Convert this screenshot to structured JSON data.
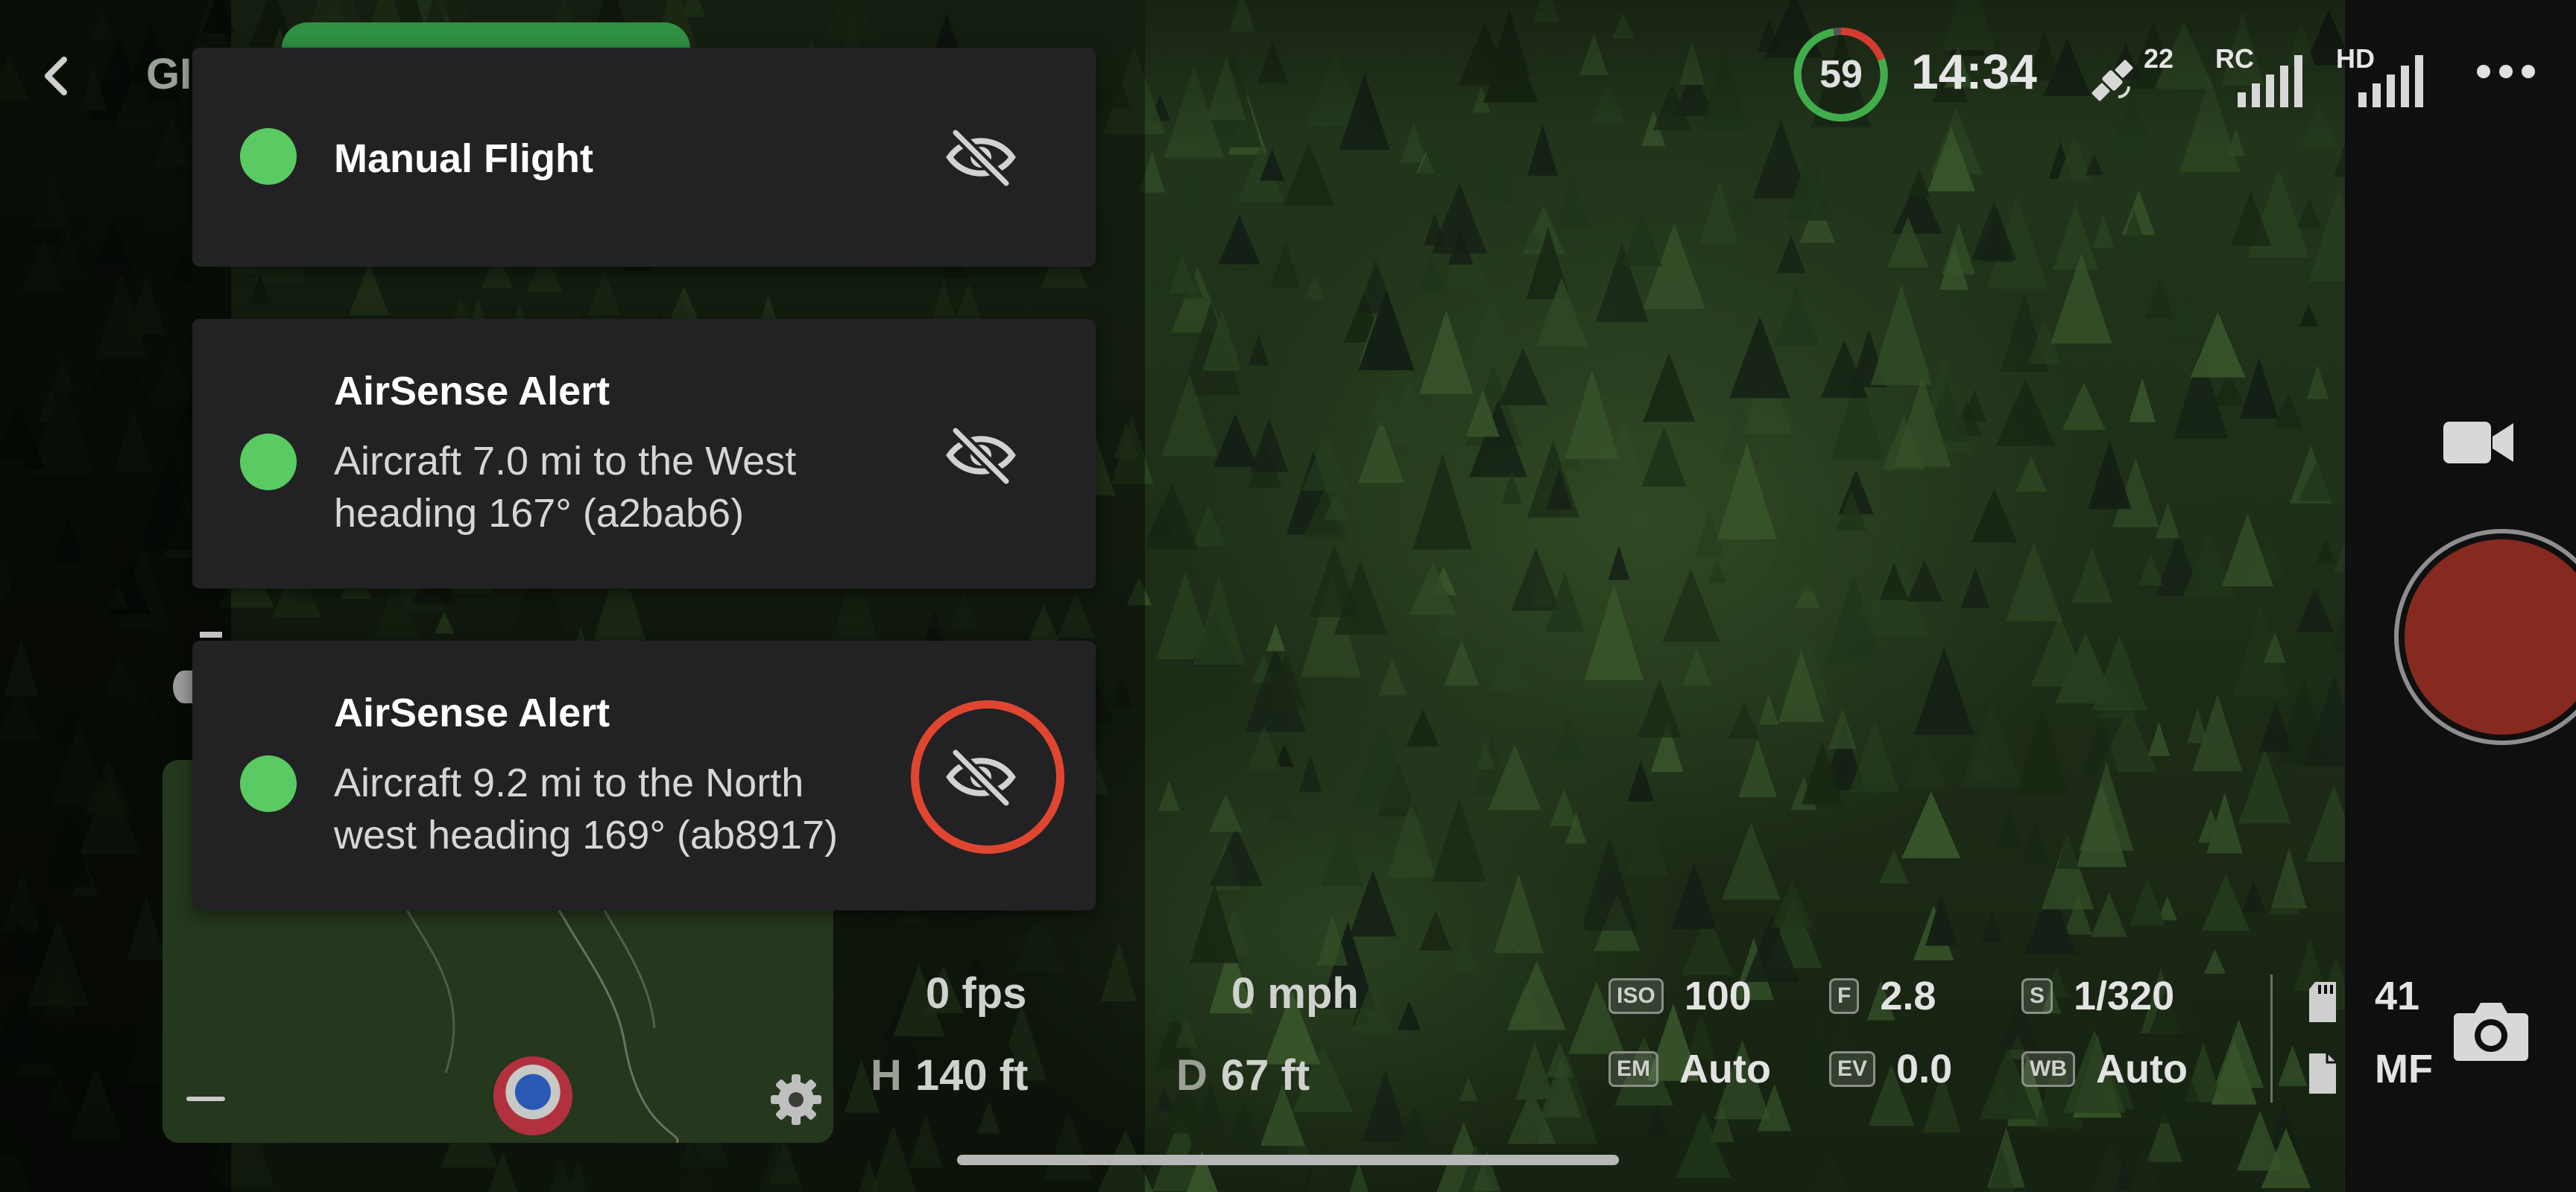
{
  "header": {
    "title_partial": "GI",
    "battery_percent": "59",
    "clock": "14:34",
    "satellite_count": "22",
    "rc_label": "RC",
    "hd_label": "HD"
  },
  "notifications": [
    {
      "title": "Manual Flight",
      "status_color": "#5acb63"
    },
    {
      "title": "AirSense Alert",
      "line1": "Aircraft 7.0 mi to the West",
      "line2": "heading 167° (a2bab6)",
      "status_color": "#5acb63"
    },
    {
      "title": "AirSense Alert",
      "line1": "Aircraft 9.2 mi to the North",
      "line2": "west heading 169° (ab8917)",
      "status_color": "#5acb63"
    }
  ],
  "telemetry": {
    "fps": "0 fps",
    "speed": "0 mph",
    "height_label": "H",
    "height": "140 ft",
    "distance_label": "D",
    "distance": "67 ft"
  },
  "camera": {
    "iso_tag": "ISO",
    "iso": "100",
    "f_tag": "F",
    "f": "2.8",
    "s_tag": "S",
    "shutter": "1/320",
    "em_tag": "EM",
    "exposure_mode": "Auto",
    "ev_tag": "EV",
    "ev": "0.0",
    "wb_tag": "WB",
    "wb": "Auto"
  },
  "storage": {
    "capacity_partial": "41",
    "format_partial": "MF"
  },
  "colors": {
    "accent_green": "#5acb63",
    "highlight_red": "#e0462f",
    "record_red": "#862a1f"
  },
  "icons": [
    "back-chevron-icon",
    "eye-off-icon",
    "gear-icon",
    "satellite-icon",
    "signal-bars-icon",
    "more-icon",
    "video-camera-icon",
    "camera-icon",
    "sd-card-icon",
    "file-icon"
  ]
}
